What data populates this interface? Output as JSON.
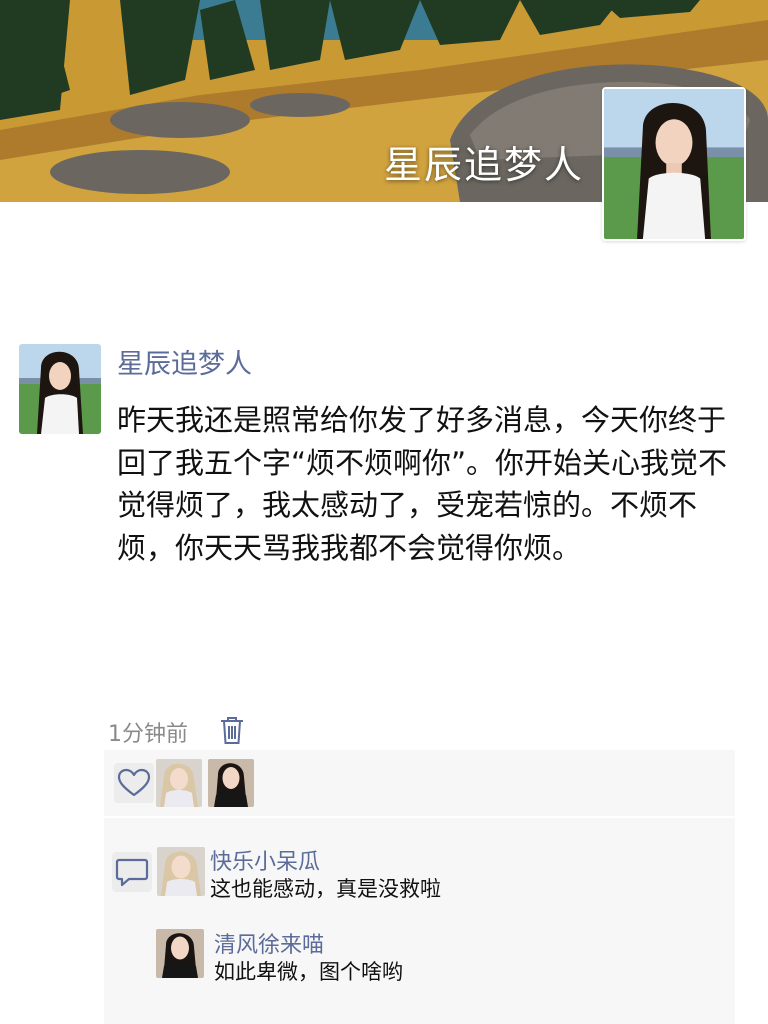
{
  "profile": {
    "name": "星辰追梦人"
  },
  "post": {
    "author": "星辰追梦人",
    "text": "昨天我还是照常给你发了好多消息，今天你终于回了我五个字“烦不烦啊你”。你开始关心我觉不觉得烦了，我太感动了，受宠若惊的。不烦不烦，你天天骂我我都不会觉得你烦。",
    "time": "1分钟前"
  },
  "likes": {
    "icon": "heart-icon",
    "users": [
      "liker-1",
      "liker-2"
    ]
  },
  "comments": {
    "icon": "comment-icon",
    "items": [
      {
        "name": "快乐小呆瓜",
        "text": "这也能感动，真是没救啦"
      },
      {
        "name": "清风徐来喵",
        "text": "如此卑微，图个啥哟"
      }
    ]
  },
  "colors": {
    "link": "#5b6b9a",
    "panel": "#f7f7f7",
    "icon": "#5b6b9a"
  }
}
